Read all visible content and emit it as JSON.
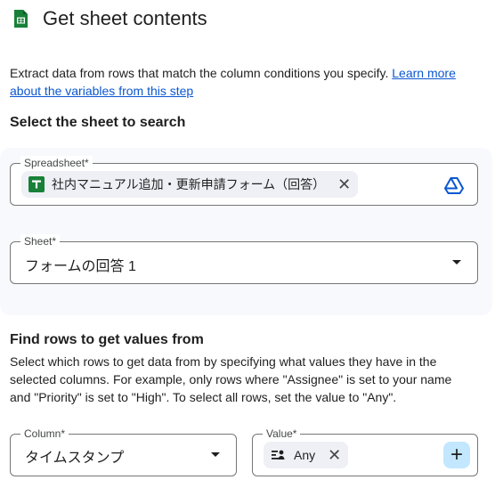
{
  "header": {
    "title": "Get sheet contents",
    "icon": "google-sheets-icon",
    "icon_color": "#188038"
  },
  "description": {
    "text": "Extract data from rows that match the column conditions you specify. ",
    "link": "Learn more about the variables from this step",
    "link_color": "#0b57d0"
  },
  "select_section": {
    "title": "Select the sheet to search",
    "spreadsheet": {
      "label": "Spreadsheet*",
      "value": "社内マニュアル追加・更新申請フォーム（回答）",
      "action_icon": "google-drive-icon"
    },
    "sheet": {
      "label": "Sheet*",
      "value": "フォームの回答 1"
    }
  },
  "find_section": {
    "title": "Find rows to get values from",
    "description": "Select which rows to get data from by specifying what values they have in the selected columns. For example, only rows where \"Assignee\" is set to your name and \"Priority\" is set to \"High\". To select all rows, set the value to \"Any\".",
    "column": {
      "label": "Column*",
      "value": "タイムスタンプ"
    },
    "value": {
      "label": "Value*",
      "chip": "Any",
      "add_symbol": "+"
    }
  },
  "colors": {
    "accent_button": "#c2e7ff",
    "chip_bg": "#eef0f5",
    "panel_bg": "#f8f9fc"
  }
}
